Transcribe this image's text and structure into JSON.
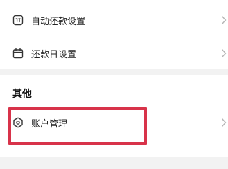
{
  "settings_list": {
    "items": [
      {
        "label": "自动还款设置",
        "icon": "auto-repay-icon"
      },
      {
        "label": "还款日设置",
        "icon": "calendar-icon"
      }
    ]
  },
  "other_section": {
    "title": "其他",
    "items": [
      {
        "label": "账户管理",
        "icon": "account-shield-icon"
      }
    ]
  },
  "annotation": {
    "highlight_color": "#d8334a",
    "highlighted_item": "账户管理"
  },
  "colors": {
    "background": "#f2f2f2",
    "card": "#ffffff",
    "text": "#222222"
  }
}
